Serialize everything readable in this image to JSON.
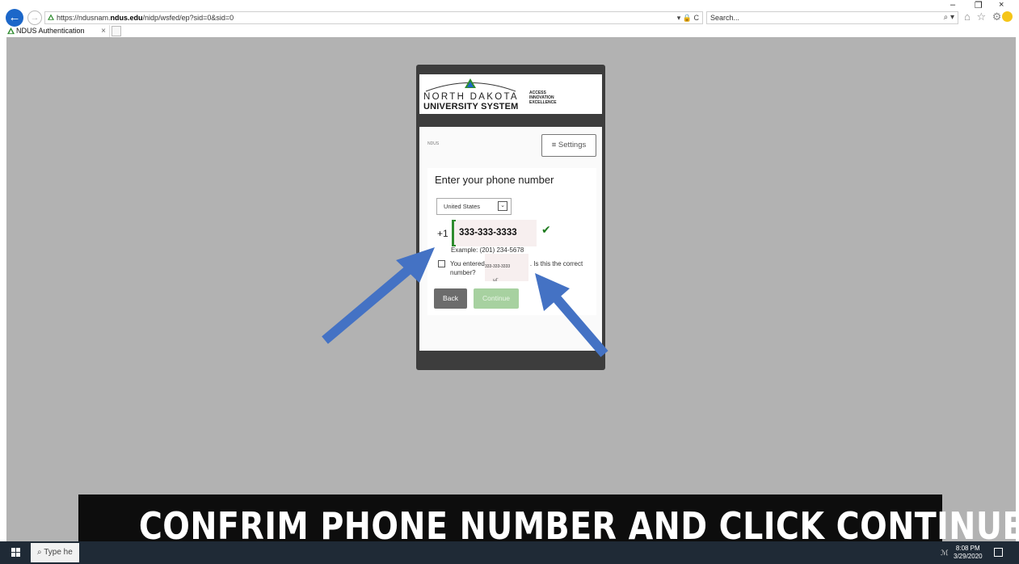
{
  "browser": {
    "url_prefix": "https://ndusnam.",
    "url_domain": "ndus.edu",
    "url_rest": "/nidp/wsfed/ep?sid=0&sid=0",
    "addr_right": "▾ 🔒 C",
    "search_placeholder": "Search...",
    "search_icon": "⌕ ▾",
    "tab_title": "NDUS Authentication",
    "tab_close": "×",
    "win_min": "–",
    "win_restore": "❐",
    "win_close": "×",
    "toolbar_icons": "⌂ ☆ ⚙",
    "back_glyph": "←",
    "fwd_glyph": "→"
  },
  "logo": {
    "line1": "NORTH DAKOTA",
    "line2": "UNIVERSITY SYSTEM",
    "tag1": "ACCESS",
    "tag2": "INNOVATION",
    "tag3": "EXCELLENCE",
    "mini": "NDUS"
  },
  "form": {
    "settings_label": "≡  Settings",
    "title": "Enter your phone number",
    "country": "United States",
    "dropdown_glyph": "⌄",
    "prefix": "+1",
    "phone_value": "333-333-3333",
    "check_glyph": "✔",
    "example": "Example: (201) 234-5678",
    "confirm_start": "You entered",
    "confirm_end": ". Is this the correct",
    "confirm_line2": "number?",
    "confirm_number": "333-333-3333",
    "tiny_mark": "ωΓ",
    "back_label": "Back",
    "continue_label": "Continue"
  },
  "caption": "CONFRIM PHONE NUMBER AND CLICK CONTINUE",
  "taskbar": {
    "search_placeholder": "Type he",
    "search_glyph": "⌕",
    "time": "8:08 PM",
    "date": "3/29/2020",
    "tray_glyph": "ℳ"
  },
  "colors": {
    "arrow": "#4472c4",
    "check": "#1d7a1d",
    "continue_bg": "#a7d1a0",
    "back_bg": "#6c6c6c"
  }
}
